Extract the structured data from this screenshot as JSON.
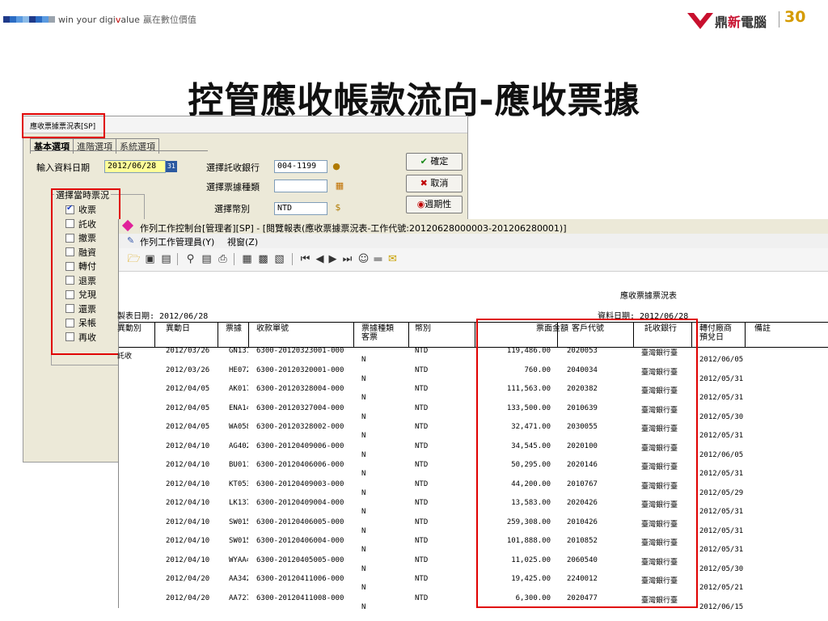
{
  "header": {
    "tagline_prefix": "win your digi",
    "tagline_v": "v",
    "tagline_suffix": "alue",
    "tagline_zh": "贏在數位價值",
    "logo_name_1": "鼎",
    "logo_name_2": "新",
    "logo_name_3": "電腦",
    "logo_30": "30",
    "square_colors": [
      "#1f3a8a",
      "#2b6cc4",
      "#5a9ae0",
      "#8bbbe8",
      "#1f3a8a",
      "#2b6cc4",
      "#5a9ae0",
      "#9aa3ad"
    ]
  },
  "slide": {
    "title": "控管應收帳款流向-應收票據"
  },
  "dialog": {
    "title": "應收票據票況表[SP]",
    "tabs": [
      "基本選項",
      "進階選項",
      "系統選項"
    ],
    "input_date_label": "輸入資料日期",
    "input_date_value": "2012/06/28",
    "calendar_icon_text": "31",
    "bank_label": "選擇託收銀行",
    "bank_value": "004-1199",
    "bill_type_label": "選擇票據種類",
    "bill_type_value": "",
    "currency_label": "選擇幣別",
    "currency_value": "NTD",
    "status_group_title": "選擇當時票況",
    "status_items": [
      {
        "label": "收票",
        "checked": true
      },
      {
        "label": "託收",
        "checked": false
      },
      {
        "label": "撤票",
        "checked": false
      },
      {
        "label": "融資",
        "checked": false
      },
      {
        "label": "轉付",
        "checked": false
      },
      {
        "label": "退票",
        "checked": false
      },
      {
        "label": "兌現",
        "checked": false
      },
      {
        "label": "還票",
        "checked": false
      },
      {
        "label": "呆帳",
        "checked": false
      },
      {
        "label": "再收",
        "checked": false
      }
    ],
    "buttons": {
      "ok": "確定",
      "cancel": "取消",
      "period": "週期性"
    }
  },
  "window": {
    "title": "作列工作控制台[管理者][SP] - [閱覽報表(應收票據票況表-工作代號:20120628000003-201206280001)]",
    "menu_job_admin": "作列工作管理員(Y)",
    "menu_window": "視窗(Z)"
  },
  "report": {
    "title": "應收票據票況表",
    "made_date_label": "製表日期: 2012/06/28",
    "data_date_label": "資料日期: 2012/06/28",
    "columns": {
      "change_type": "異動別",
      "change_date": "異動日",
      "bill_no": "票據",
      "receipt_no": "收款單號",
      "bill_type": "票據種類",
      "bill_type_2": "客票",
      "currency": "幣別",
      "amount": "票面金額",
      "customer": "客戶代號",
      "bank": "託收銀行",
      "transfer": "轉付廠商",
      "transfer_2": "預兌日",
      "note": "備註"
    },
    "first_row_type": "託收",
    "rows": [
      {
        "date": "2012/03/26",
        "bill": "GN131",
        "receipt": "6300-20120323001-000",
        "type": "N",
        "currency": "NTD",
        "amount": "119,486.00",
        "customer": "2020053",
        "bank": "臺灣銀行臺",
        "due": "2012/06/05"
      },
      {
        "date": "2012/03/26",
        "bill": "HE072",
        "receipt": "6300-20120320001-000",
        "type": "N",
        "currency": "NTD",
        "amount": "760.00",
        "customer": "2040034",
        "bank": "臺灣銀行臺",
        "due": "2012/05/31"
      },
      {
        "date": "2012/04/05",
        "bill": "AK017",
        "receipt": "6300-20120328004-000",
        "type": "N",
        "currency": "NTD",
        "amount": "111,563.00",
        "customer": "2020382",
        "bank": "臺灣銀行臺",
        "due": "2012/05/31"
      },
      {
        "date": "2012/04/05",
        "bill": "ENA14",
        "receipt": "6300-20120327004-000",
        "type": "N",
        "currency": "NTD",
        "amount": "133,500.00",
        "customer": "2010639",
        "bank": "臺灣銀行臺",
        "due": "2012/05/30"
      },
      {
        "date": "2012/04/05",
        "bill": "WA058",
        "receipt": "6300-20120328002-000",
        "type": "N",
        "currency": "NTD",
        "amount": "32,471.00",
        "customer": "2030055",
        "bank": "臺灣銀行臺",
        "due": "2012/05/31"
      },
      {
        "date": "2012/04/10",
        "bill": "AG402",
        "receipt": "6300-20120409006-000",
        "type": "N",
        "currency": "NTD",
        "amount": "34,545.00",
        "customer": "2020100",
        "bank": "臺灣銀行臺",
        "due": "2012/06/05"
      },
      {
        "date": "2012/04/10",
        "bill": "BU011",
        "receipt": "6300-20120406006-000",
        "type": "N",
        "currency": "NTD",
        "amount": "50,295.00",
        "customer": "2020146",
        "bank": "臺灣銀行臺",
        "due": "2012/05/31"
      },
      {
        "date": "2012/04/10",
        "bill": "KT053",
        "receipt": "6300-20120409003-000",
        "type": "N",
        "currency": "NTD",
        "amount": "44,200.00",
        "customer": "2010767",
        "bank": "臺灣銀行臺",
        "due": "2012/05/29"
      },
      {
        "date": "2012/04/10",
        "bill": "LK137",
        "receipt": "6300-20120409004-000",
        "type": "N",
        "currency": "NTD",
        "amount": "13,583.00",
        "customer": "2020426",
        "bank": "臺灣銀行臺",
        "due": "2012/05/31"
      },
      {
        "date": "2012/04/10",
        "bill": "SW015",
        "receipt": "6300-20120406005-000",
        "type": "N",
        "currency": "NTD",
        "amount": "259,308.00",
        "customer": "2010426",
        "bank": "臺灣銀行臺",
        "due": "2012/05/31"
      },
      {
        "date": "2012/04/10",
        "bill": "SW015",
        "receipt": "6300-20120406004-000",
        "type": "N",
        "currency": "NTD",
        "amount": "101,888.00",
        "customer": "2010852",
        "bank": "臺灣銀行臺",
        "due": "2012/05/31"
      },
      {
        "date": "2012/04/10",
        "bill": "WYAA4",
        "receipt": "6300-20120405005-000",
        "type": "N",
        "currency": "NTD",
        "amount": "11,025.00",
        "customer": "2060540",
        "bank": "臺灣銀行臺",
        "due": "2012/05/30"
      },
      {
        "date": "2012/04/20",
        "bill": "AA342",
        "receipt": "6300-20120411006-000",
        "type": "N",
        "currency": "NTD",
        "amount": "19,425.00",
        "customer": "2240012",
        "bank": "臺灣銀行臺",
        "due": "2012/05/21"
      },
      {
        "date": "2012/04/20",
        "bill": "AA727",
        "receipt": "6300-20120411008-000",
        "type": "N",
        "currency": "NTD",
        "amount": "6,300.00",
        "customer": "2020477",
        "bank": "臺灣銀行臺",
        "due": "2012/06/15"
      }
    ]
  }
}
